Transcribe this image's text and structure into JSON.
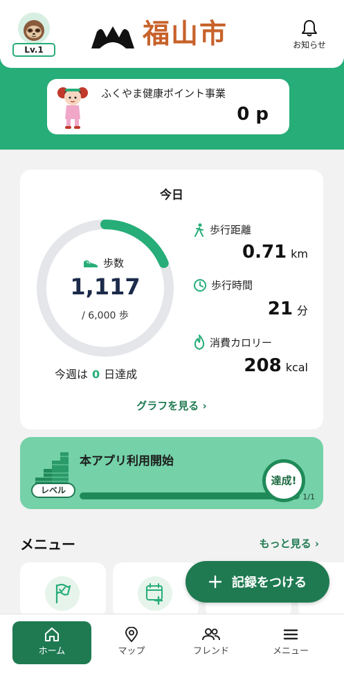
{
  "header": {
    "level": "Lv.1",
    "city_title": "福山市",
    "notification_label": "お知らせ"
  },
  "points": {
    "title": "ふくやま健康ポイント事業",
    "value": "0 p"
  },
  "today": {
    "title": "今日",
    "steps_label": "歩数",
    "steps_value": "1,117",
    "steps_goal": "/ 6,000 歩",
    "steps_progress": 0.186,
    "week_prefix": "今週は",
    "week_days": "0",
    "week_suffix": "日達成",
    "distance_label": "歩行距離",
    "distance_value": "0.71",
    "distance_unit": "km",
    "time_label": "歩行時間",
    "time_value": "21",
    "time_unit": "分",
    "calorie_label": "消費カロリー",
    "calorie_value": "208",
    "calorie_unit": "kcal",
    "graph_link": "グラフを見る ›"
  },
  "level_card": {
    "pill": "レベル",
    "title": "本アプリ利用開始",
    "badge": "達成!",
    "progress": 1.0,
    "count": "1/1"
  },
  "menu": {
    "title": "メニュー",
    "more": "もっと見る ›"
  },
  "record_button": {
    "label": "記録をつける"
  },
  "nav": {
    "items": [
      {
        "label": "ホーム",
        "icon": "home-icon"
      },
      {
        "label": "マップ",
        "icon": "map-pin-icon"
      },
      {
        "label": "フレンド",
        "icon": "friends-icon"
      },
      {
        "label": "メニュー",
        "icon": "hamburger-icon"
      }
    ]
  },
  "colors": {
    "primary_green": "#26ad78",
    "dark_green": "#1f7a52",
    "title_orange": "#c8622b"
  }
}
